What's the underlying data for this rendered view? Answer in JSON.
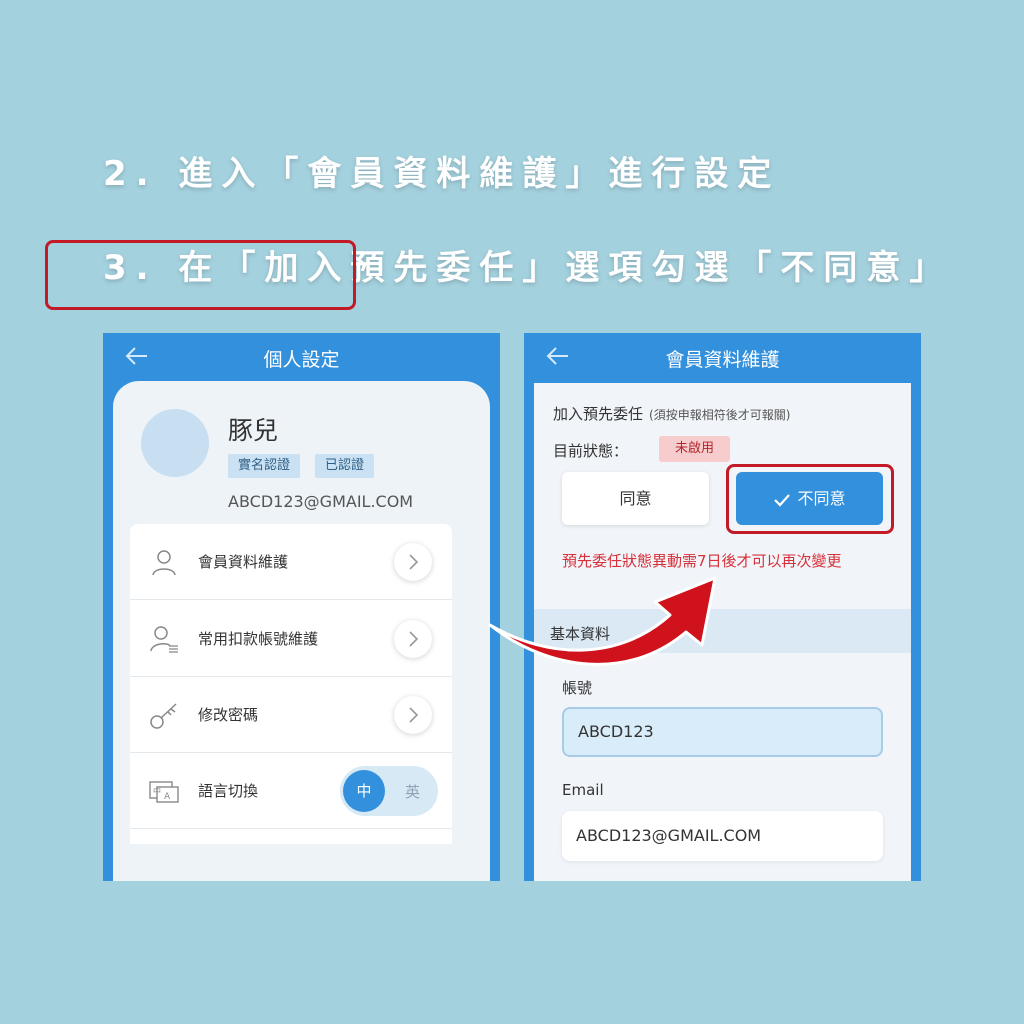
{
  "instructions": {
    "step2": "2. 進入「會員資料維護」進行設定",
    "step3": "3. 在「加入預先委任」選項勾選「不同意」"
  },
  "phone1": {
    "title": "個人設定",
    "profile": {
      "name": "豚兒",
      "badges": [
        "實名認證",
        "已認證"
      ],
      "email": "ABCD123@GMAIL.COM"
    },
    "menu": [
      {
        "label": "會員資料維護",
        "icon": "user-icon"
      },
      {
        "label": "常用扣款帳號維護",
        "icon": "user-list-icon"
      },
      {
        "label": "修改密碼",
        "icon": "key-icon"
      },
      {
        "label": "語言切換",
        "icon": "language-icon"
      }
    ],
    "language": {
      "zh": "中",
      "en": "英",
      "selected": "中"
    }
  },
  "phone2": {
    "title": "會員資料維護",
    "delegate_title": "加入預先委任",
    "delegate_note": "(須按申報相符後才可報關)",
    "status_label": "目前狀態：",
    "status_value": "未啟用",
    "agree_label": "同意",
    "disagree_label": "不同意",
    "warning": "預先委任狀態異動需7日後才可以再次變更",
    "section_title": "基本資料",
    "account_label": "帳號",
    "account_value": "ABCD123",
    "email_label": "Email",
    "email_value": "ABCD123@GMAIL.COM"
  },
  "colors": {
    "background": "#a4d1de",
    "primary": "#3390dc",
    "highlight": "#c21a27",
    "warning": "#d8303a"
  }
}
